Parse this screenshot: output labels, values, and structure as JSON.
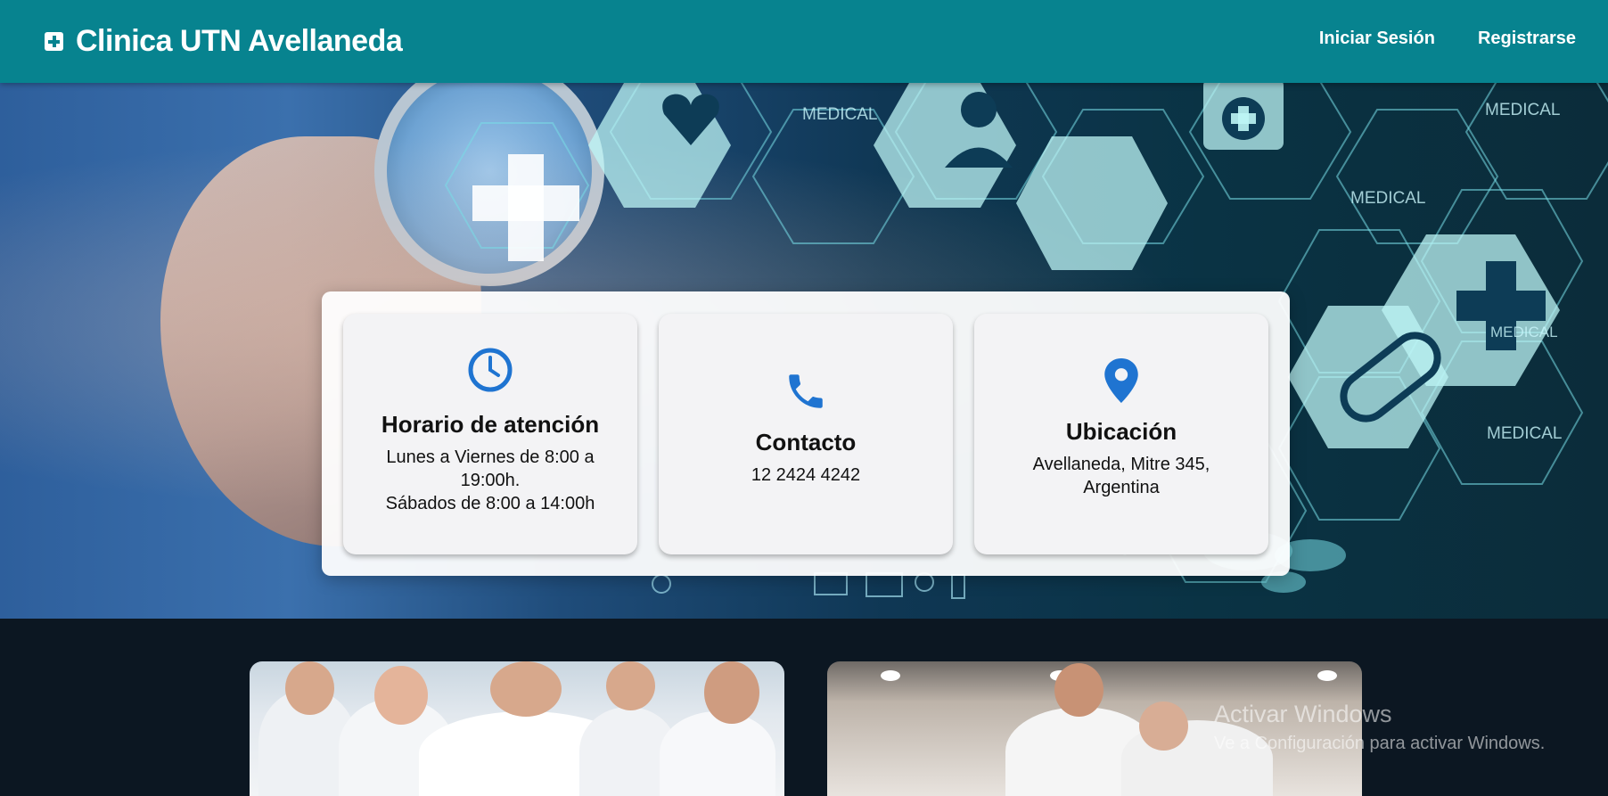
{
  "navbar": {
    "brand": "Clinica UTN Avellaneda",
    "links": [
      "Iniciar Sesión",
      "Registrarse"
    ]
  },
  "hero": {
    "background_labels": [
      "MEDICAL",
      "MEDICAL",
      "MEDICAL",
      "MEDICAL",
      "MEDICAL"
    ],
    "cards": [
      {
        "icon": "clock-icon",
        "title": "Horario de atención",
        "lines": [
          "Lunes a Viernes de 8:00 a",
          "19:00h.",
          "Sábados de 8:00 a 14:00h"
        ]
      },
      {
        "icon": "phone-icon",
        "title": "Contacto",
        "lines": [
          "12 2424 4242"
        ]
      },
      {
        "icon": "location-pin-icon",
        "title": "Ubicación",
        "lines": [
          "Avellaneda, Mitre 345,",
          "Argentina"
        ]
      }
    ]
  },
  "gallery": {
    "images": [
      "doctors-team-photo",
      "patient-care-photo"
    ]
  },
  "watermark": {
    "title": "Activar Windows",
    "subtitle": "Ve a Configuración para activar Windows."
  },
  "colors": {
    "navbar": "#07838f",
    "icon_blue": "#1f74d1",
    "page_dark": "#0c1722"
  }
}
